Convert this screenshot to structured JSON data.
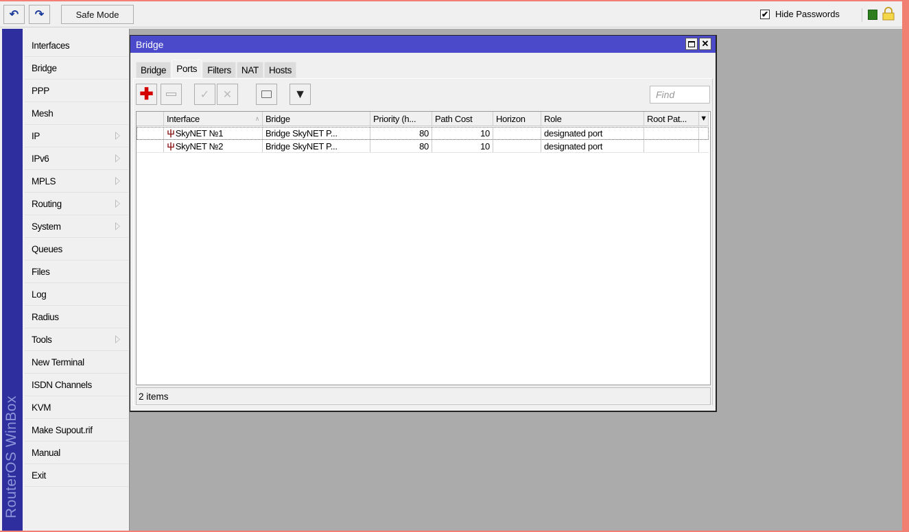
{
  "toolbar": {
    "undo_icon": "undo-icon",
    "redo_icon": "redo-icon",
    "safe_mode": "Safe Mode",
    "hide_passwords": "Hide Passwords",
    "hide_passwords_checked": true
  },
  "sidebar": {
    "brand": "RouterOS WinBox",
    "items": [
      {
        "label": "Interfaces",
        "submenu": false
      },
      {
        "label": "Bridge",
        "submenu": false
      },
      {
        "label": "PPP",
        "submenu": false
      },
      {
        "label": "Mesh",
        "submenu": false
      },
      {
        "label": "IP",
        "submenu": true
      },
      {
        "label": "IPv6",
        "submenu": true
      },
      {
        "label": "MPLS",
        "submenu": true
      },
      {
        "label": "Routing",
        "submenu": true
      },
      {
        "label": "System",
        "submenu": true
      },
      {
        "label": "Queues",
        "submenu": false
      },
      {
        "label": "Files",
        "submenu": false
      },
      {
        "label": "Log",
        "submenu": false
      },
      {
        "label": "Radius",
        "submenu": false
      },
      {
        "label": "Tools",
        "submenu": true
      },
      {
        "label": "New Terminal",
        "submenu": false
      },
      {
        "label": "ISDN Channels",
        "submenu": false
      },
      {
        "label": "KVM",
        "submenu": false
      },
      {
        "label": "Make Supout.rif",
        "submenu": false
      },
      {
        "label": "Manual",
        "submenu": false
      },
      {
        "label": "Exit",
        "submenu": false
      }
    ]
  },
  "window": {
    "title": "Bridge",
    "tabs": [
      "Bridge",
      "Ports",
      "Filters",
      "NAT",
      "Hosts"
    ],
    "active_tab": "Ports",
    "find_placeholder": "Find",
    "columns": [
      "",
      "Interface",
      "Bridge",
      "Priority (h...",
      "Path Cost",
      "Horizon",
      "Role",
      "Root Pat..."
    ],
    "rows": [
      {
        "interface": "SkyNET №1",
        "bridge": "Bridge SkyNET P...",
        "priority": "80",
        "path_cost": "10",
        "horizon": "",
        "role": "designated port",
        "root_path": ""
      },
      {
        "interface": "SkyNET №2",
        "bridge": "Bridge SkyNET P...",
        "priority": "80",
        "path_cost": "10",
        "horizon": "",
        "role": "designated port",
        "root_path": ""
      }
    ],
    "status": "2 items"
  },
  "colors": {
    "title_bar": "#4a4acb",
    "brand_band": "#2e2e9e",
    "workspace": "#ababab",
    "frame": "#f28072"
  }
}
